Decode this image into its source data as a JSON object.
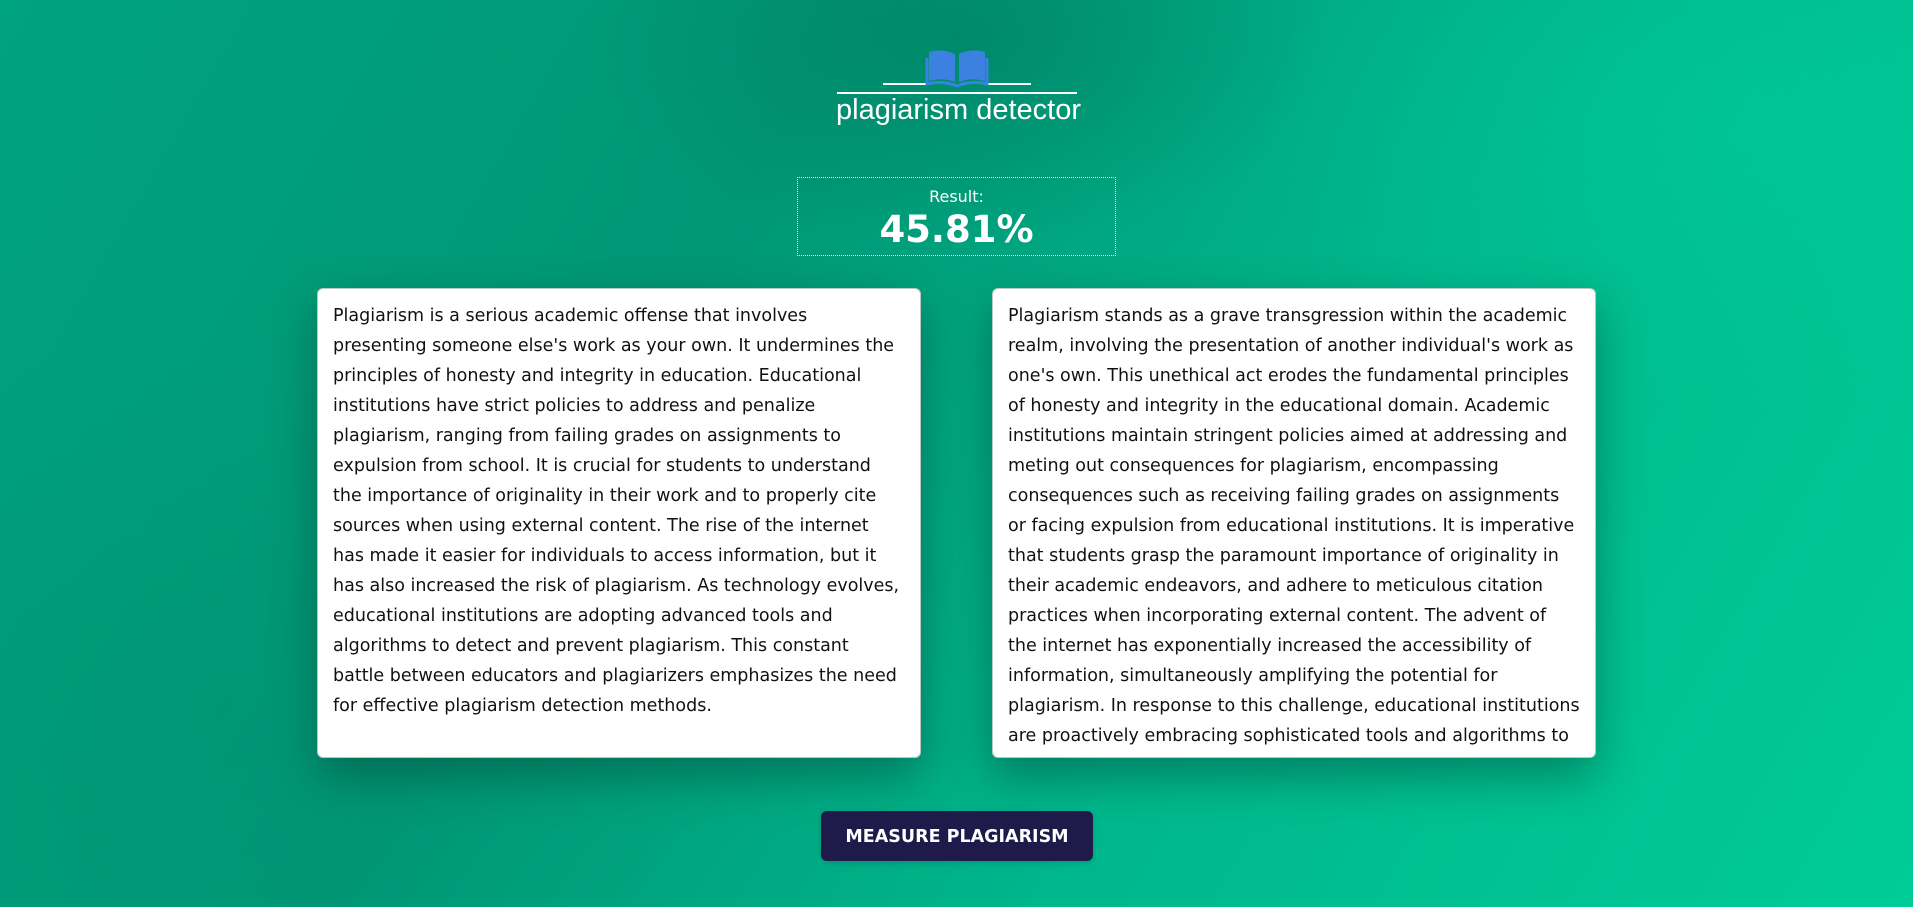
{
  "header": {
    "logo_icon": "open-book-icon",
    "logo_text": "plagiarism detector",
    "accent_color": "#3b82e0"
  },
  "result": {
    "label": "Result:",
    "value": "45.81%"
  },
  "panels": {
    "left_text": "Plagiarism is a serious academic offense that involves presenting someone else's work as your own. It undermines the principles of honesty and integrity in education. Educational institutions have strict policies to address and penalize plagiarism, ranging from failing grades on assignments to expulsion from school. It is crucial for students to understand the importance of originality in their work and to properly cite sources when using external content. The rise of the internet has made it easier for individuals to access information, but it has also increased the risk of plagiarism. As technology evolves, educational institutions are adopting advanced tools and algorithms to detect and prevent plagiarism. This constant battle between educators and plagiarizers emphasizes the need for effective plagiarism detection methods.",
    "right_text": "Plagiarism stands as a grave transgression within the academic realm, involving the presentation of another individual's work as one's own. This unethical act erodes the fundamental principles of honesty and integrity in the educational domain. Academic institutions maintain stringent policies aimed at addressing and meting out consequences for plagiarism, encompassing consequences such as receiving failing grades on assignments or facing expulsion from educational institutions. It is imperative that students grasp the paramount importance of originality in their academic endeavors, and adhere to meticulous citation practices when incorporating external content. The advent of the internet has exponentially increased the accessibility of information, simultaneously amplifying the potential for plagiarism. In response to this challenge, educational institutions are proactively embracing sophisticated tools and algorithms to identify and prevent instances of plagiarism with greater"
  },
  "actions": {
    "measure_label": "MEASURE PLAGIARISM",
    "button_color": "#1e1a4a"
  }
}
